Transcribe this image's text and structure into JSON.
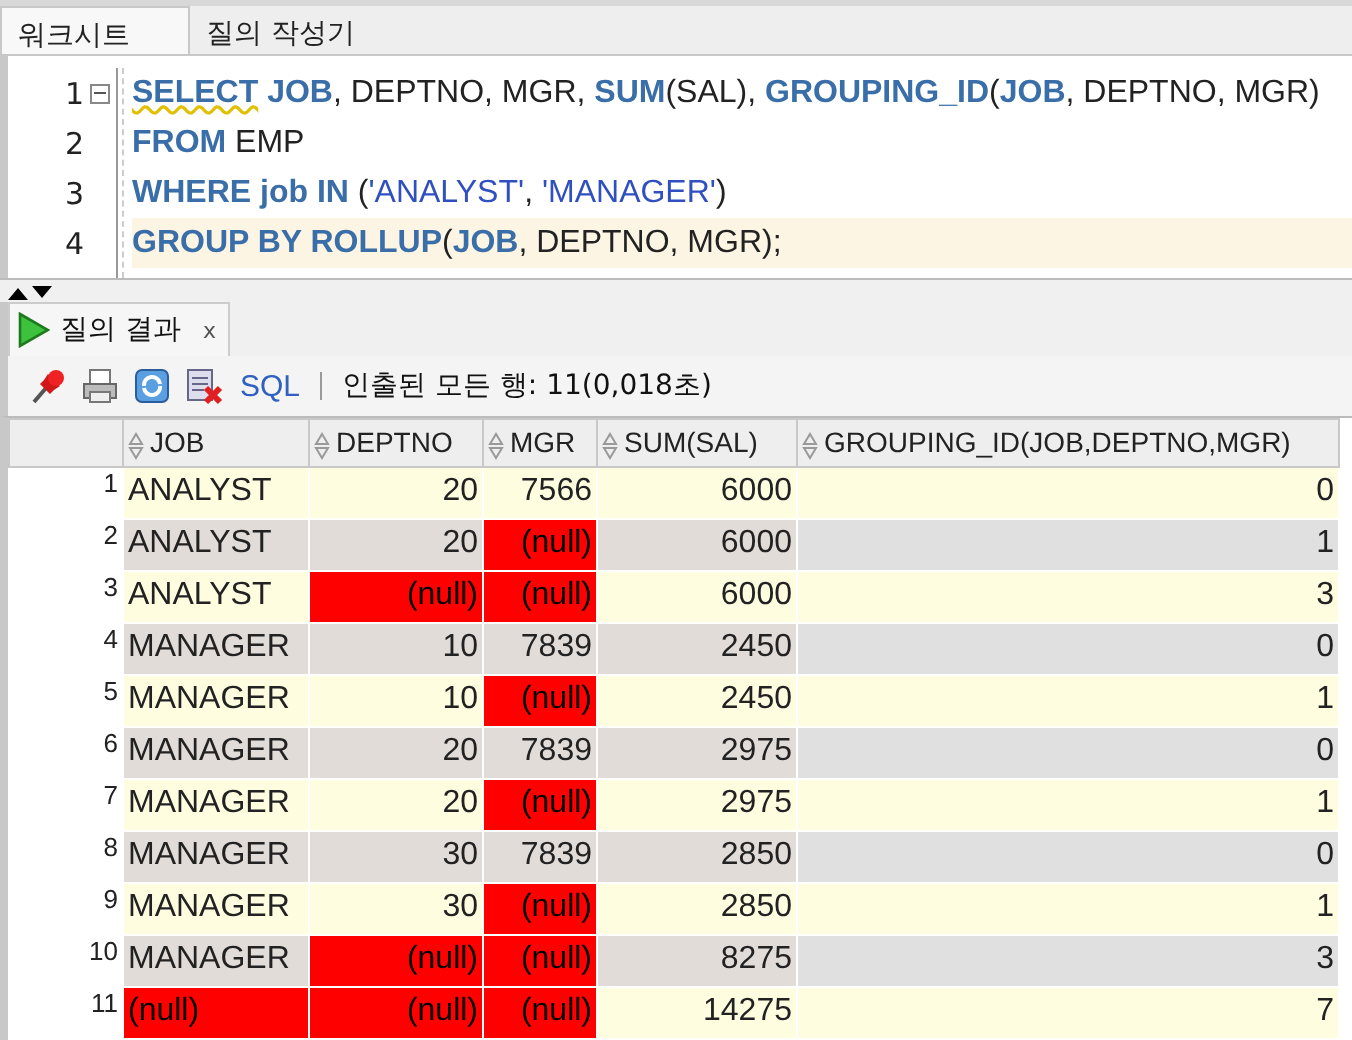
{
  "tabs": [
    {
      "label": "워크시트",
      "selected": true
    },
    {
      "label": "질의 작성기",
      "selected": false
    }
  ],
  "editor": {
    "lines": [
      {
        "number": "1",
        "folded": false,
        "current": false,
        "tokens": [
          {
            "kind": "keyword",
            "text": "SELECT",
            "underlined": true
          },
          {
            "kind": "keyword",
            "text": " JOB"
          },
          {
            "kind": "plain",
            "text": ", DEPTNO, MGR, "
          },
          {
            "kind": "keyword",
            "text": "SUM"
          },
          {
            "kind": "plain",
            "text": "(SAL), "
          },
          {
            "kind": "keyword",
            "text": "GROUPING_ID"
          },
          {
            "kind": "plain",
            "text": "("
          },
          {
            "kind": "keyword",
            "text": "JOB"
          },
          {
            "kind": "plain",
            "text": ", DEPTNO, MGR)"
          }
        ]
      },
      {
        "number": "2",
        "current": false,
        "tokens": [
          {
            "kind": "keyword",
            "text": "FROM"
          },
          {
            "kind": "plain",
            "text": " EMP"
          }
        ]
      },
      {
        "number": "3",
        "current": false,
        "tokens": [
          {
            "kind": "keyword",
            "text": "WHERE job IN"
          },
          {
            "kind": "plain",
            "text": " ("
          },
          {
            "kind": "string",
            "text": "'ANALYST'"
          },
          {
            "kind": "plain",
            "text": ", "
          },
          {
            "kind": "string",
            "text": "'MANAGER'"
          },
          {
            "kind": "plain",
            "text": ")"
          }
        ]
      },
      {
        "number": "4",
        "current": true,
        "tokens": [
          {
            "kind": "keyword",
            "text": "GROUP BY ROLLUP"
          },
          {
            "kind": "plain",
            "text": "("
          },
          {
            "kind": "keyword",
            "text": "JOB"
          },
          {
            "kind": "plain",
            "text": ", DEPTNO, MGR);"
          }
        ]
      }
    ]
  },
  "results_tab": {
    "label": "질의 결과",
    "close": "x"
  },
  "toolbar": {
    "sql_link": "SQL",
    "status": "인출된 모든 행: 11(0,018초)"
  },
  "table": {
    "columns": [
      {
        "label": "JOB"
      },
      {
        "label": "DEPTNO"
      },
      {
        "label": "MGR"
      },
      {
        "label": "SUM(SAL)"
      },
      {
        "label": "GROUPING_ID(JOB,DEPTNO,MGR)"
      }
    ],
    "rows": [
      {
        "number": "1",
        "cells": [
          {
            "text": "ANALYST",
            "null": false
          },
          {
            "text": "20",
            "null": false
          },
          {
            "text": "7566",
            "null": false
          },
          {
            "text": "6000",
            "null": false
          },
          {
            "text": "0",
            "null": false
          }
        ]
      },
      {
        "number": "2",
        "cells": [
          {
            "text": "ANALYST",
            "null": false
          },
          {
            "text": "20",
            "null": false
          },
          {
            "text": "(null)",
            "null": true
          },
          {
            "text": "6000",
            "null": false
          },
          {
            "text": "1",
            "null": false
          }
        ]
      },
      {
        "number": "3",
        "cells": [
          {
            "text": "ANALYST",
            "null": false
          },
          {
            "text": "(null)",
            "null": true
          },
          {
            "text": "(null)",
            "null": true
          },
          {
            "text": "6000",
            "null": false
          },
          {
            "text": "3",
            "null": false
          }
        ]
      },
      {
        "number": "4",
        "cells": [
          {
            "text": "MANAGER",
            "null": false
          },
          {
            "text": "10",
            "null": false
          },
          {
            "text": "7839",
            "null": false
          },
          {
            "text": "2450",
            "null": false
          },
          {
            "text": "0",
            "null": false
          }
        ]
      },
      {
        "number": "5",
        "cells": [
          {
            "text": "MANAGER",
            "null": false
          },
          {
            "text": "10",
            "null": false
          },
          {
            "text": "(null)",
            "null": true
          },
          {
            "text": "2450",
            "null": false
          },
          {
            "text": "1",
            "null": false
          }
        ]
      },
      {
        "number": "6",
        "cells": [
          {
            "text": "MANAGER",
            "null": false
          },
          {
            "text": "20",
            "null": false
          },
          {
            "text": "7839",
            "null": false
          },
          {
            "text": "2975",
            "null": false
          },
          {
            "text": "0",
            "null": false
          }
        ]
      },
      {
        "number": "7",
        "cells": [
          {
            "text": "MANAGER",
            "null": false
          },
          {
            "text": "20",
            "null": false
          },
          {
            "text": "(null)",
            "null": true
          },
          {
            "text": "2975",
            "null": false
          },
          {
            "text": "1",
            "null": false
          }
        ]
      },
      {
        "number": "8",
        "cells": [
          {
            "text": "MANAGER",
            "null": false
          },
          {
            "text": "30",
            "null": false
          },
          {
            "text": "7839",
            "null": false
          },
          {
            "text": "2850",
            "null": false
          },
          {
            "text": "0",
            "null": false
          }
        ]
      },
      {
        "number": "9",
        "cells": [
          {
            "text": "MANAGER",
            "null": false
          },
          {
            "text": "30",
            "null": false
          },
          {
            "text": "(null)",
            "null": true
          },
          {
            "text": "2850",
            "null": false
          },
          {
            "text": "1",
            "null": false
          }
        ]
      },
      {
        "number": "10",
        "cells": [
          {
            "text": "MANAGER",
            "null": false
          },
          {
            "text": "(null)",
            "null": true
          },
          {
            "text": "(null)",
            "null": true
          },
          {
            "text": "8275",
            "null": false
          },
          {
            "text": "3",
            "null": false
          }
        ]
      },
      {
        "number": "11",
        "cells": [
          {
            "text": "(null)",
            "null": true
          },
          {
            "text": "(null)",
            "null": true
          },
          {
            "text": "(null)",
            "null": true
          },
          {
            "text": "14275",
            "null": false
          },
          {
            "text": "7",
            "null": false
          }
        ]
      }
    ]
  }
}
